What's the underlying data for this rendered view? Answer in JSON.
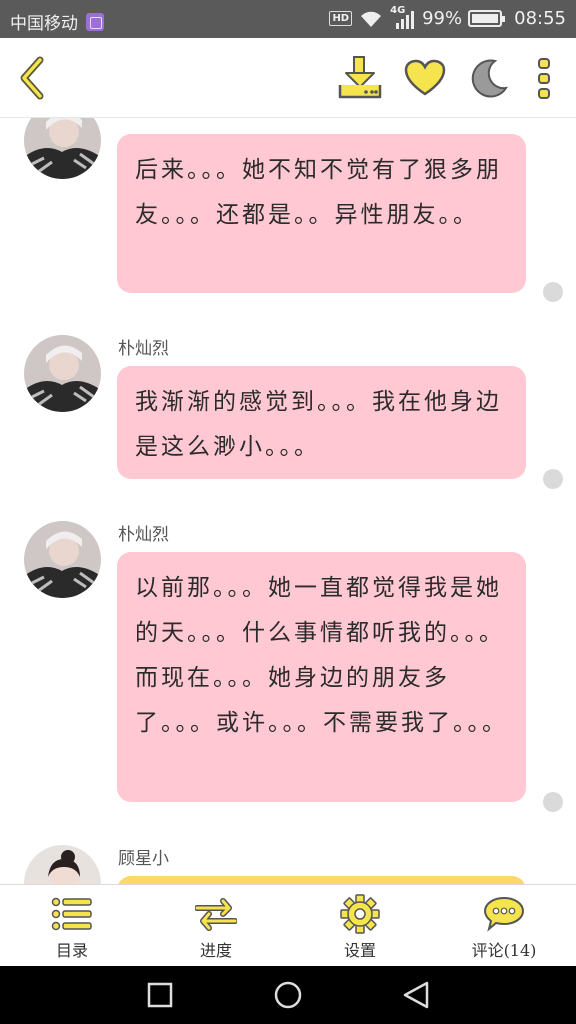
{
  "status_bar": {
    "carrier": "中国移动",
    "network": "4G",
    "battery": "99%",
    "time": "08:55"
  },
  "toolbar": {
    "icons": [
      "back-chevron-icon",
      "download-icon",
      "heart-icon",
      "moon-icon",
      "more-vertical-icon"
    ],
    "accent_color": "#f5e44e"
  },
  "messages": [
    {
      "sender": "",
      "text": "后来。。。她不知不觉有了狠多朋友。。。还都是。。异性朋友。。",
      "bubble_color": "#ffc8d3"
    },
    {
      "sender": "朴灿烈",
      "text": "我渐渐的感觉到。。。我在他身边是这么渺小。。。",
      "bubble_color": "#ffc8d3"
    },
    {
      "sender": "朴灿烈",
      "text": "以前那。。。她一直都觉得我是她的天。。。什么事情都听我的。。。而现在。。。她身边的朋友多了。。。或许。。。不需要我了。。。",
      "bubble_color": "#ffc8d3"
    },
    {
      "sender": "顾星小",
      "text": "",
      "bubble_color": "#fcd86a"
    }
  ],
  "bottom_nav": [
    {
      "label": "目录",
      "icon": "list-icon"
    },
    {
      "label": "进度",
      "icon": "swap-arrows-icon"
    },
    {
      "label": "设置",
      "icon": "gear-icon"
    },
    {
      "label": "评论(14)",
      "icon": "comment-bubble-icon"
    }
  ],
  "system_nav": [
    "recent-apps-icon",
    "home-icon",
    "back-icon"
  ]
}
